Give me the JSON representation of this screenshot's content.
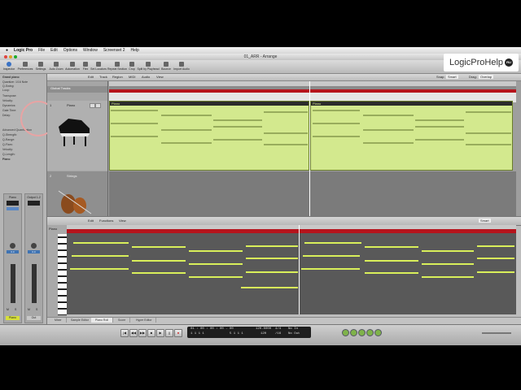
{
  "menubar": {
    "apple": "",
    "items": [
      "Logic Pro",
      "File",
      "Edit",
      "Options",
      "Window",
      "Screenset 2",
      "Help"
    ]
  },
  "window": {
    "title": "01_ARR - Arrange"
  },
  "watermark": {
    "text": "LogicProHelp",
    "badge": "RU"
  },
  "toolbar": {
    "items": [
      "Inspector",
      "Preferences",
      "Settings",
      "Auto Zoom",
      "Automation",
      "Flex",
      "Set Locators",
      "Repeat Section",
      "Crop",
      "Split by Playhead",
      "Bounce",
      "Import Audio"
    ]
  },
  "arrange": {
    "menu": [
      "Edit",
      "Track",
      "Region",
      "MIDI",
      "Audio",
      "View"
    ],
    "snap_label": "Snap:",
    "snap_value": "Smart",
    "drag_label": "Drag:",
    "drag_value": "Overlap",
    "global_tracks_label": "Global Tracks",
    "tracks": [
      {
        "number": "1",
        "name": "Piano"
      },
      {
        "number": "2",
        "name": "Strings"
      }
    ],
    "regions": [
      "Piano",
      "Piano"
    ]
  },
  "inspector": {
    "section": "Grand piano",
    "rows": [
      "Quantize: 1/16 Note",
      "Q-Swing:",
      "Loop:",
      "Transpose:",
      "Velocity:",
      "Dynamics:",
      "Gate Time:",
      "Delay:",
      "Advanced Quantization",
      "Q-Strength:",
      "Q-Range:",
      "Q-Flam:",
      "Velocity:",
      "Q-Length:"
    ],
    "track_section": "Piano",
    "strip_left": {
      "name": "Piano",
      "label": "Piano",
      "pan": "0.0"
    },
    "strip_right": {
      "name": "Output 1-2",
      "label": "Out",
      "pan": "0.0"
    },
    "buttons": [
      "M",
      "S",
      "M",
      "S",
      "Bnce"
    ]
  },
  "piano_roll": {
    "menu": [
      "Edit",
      "Functions",
      "View"
    ],
    "region_label": "Piano",
    "snap_value": "Smart"
  },
  "bottom_tabs": [
    "Mixer",
    "Sample Editor",
    "Piano Roll",
    "Score",
    "Hyper Editor"
  ],
  "transport": {
    "position_bars": "01 : 00 : 00 : 00 . 00",
    "position_beats": "1   1   1   1",
    "end_position": "5   1   1   1",
    "tempo": "120.0000",
    "tempo_sub": "120",
    "signature": "4/4",
    "division": "/16",
    "in_label": "No In",
    "out_label": "No Out"
  }
}
